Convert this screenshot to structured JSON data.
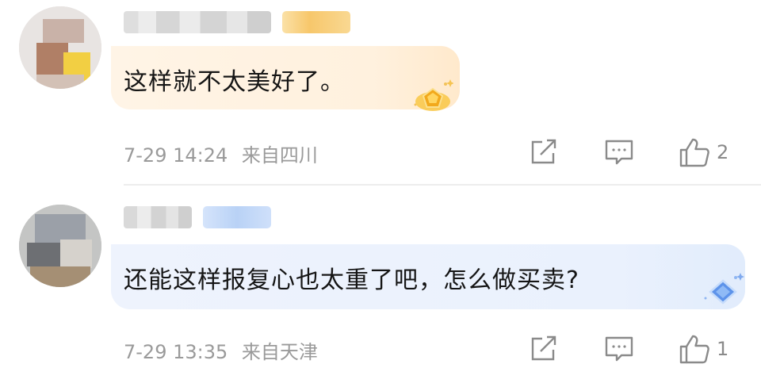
{
  "comments": [
    {
      "text": "这样就不太美好了。",
      "time": "7-29 14:24",
      "location": "来自四川",
      "likes": "2",
      "level_theme": "gold"
    },
    {
      "text": "还能这样报复心也太重了吧，怎么做买卖?",
      "time": "7-29 13:35",
      "location": "来自天津",
      "likes": "1",
      "level_theme": "blue"
    }
  ],
  "icons": {
    "share": "share-icon",
    "comment": "comment-icon",
    "like": "thumbs-up-icon"
  },
  "colors": {
    "meta_text": "#9a9a9a",
    "icon": "#8a8a8a",
    "gold_bubble": "#fff1de",
    "blue_bubble": "#eaf1fd"
  }
}
